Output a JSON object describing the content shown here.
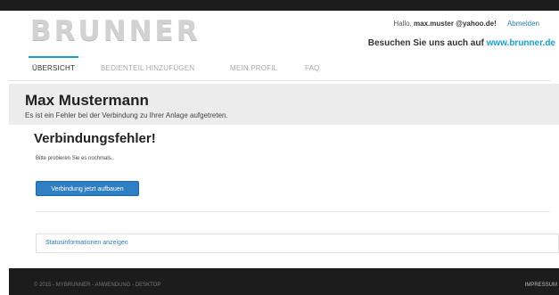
{
  "header": {
    "logo_text": "BRUNNER",
    "greeting_prefix": "Hallo,",
    "user_email": "max.muster @yahoo.de!",
    "logout_label": "Abmelden",
    "visit_text": "Besuchen Sie uns auch auf",
    "visit_link": "www.brunner.de"
  },
  "nav": {
    "tabs": [
      {
        "label": "ÜBERSICHT",
        "active": true
      },
      {
        "label": "BEDIENTEIL HINZUFÜGEN",
        "active": false
      },
      {
        "label": "MEIN PROFIL",
        "active": false
      },
      {
        "label": "FAQ",
        "active": false
      }
    ]
  },
  "hero": {
    "title": "Max Mustermann",
    "subtitle": "Es ist ein Fehler bei der Verbindung zu Ihrer Anlage aufgetreten."
  },
  "error": {
    "title": "Verbindungsfehler!",
    "message": "Bitte probieren Sie es nochmals..",
    "button_label": "Verbindung jetzt aufbauen"
  },
  "status": {
    "link_label": "Statusinformationen anzeigen"
  },
  "footer": {
    "copyright": "© 2015 - MYBRUNNER - ANWENDUNG - DESKTOP",
    "impressum_label": "IMPRESSUM"
  },
  "colors": {
    "accent": "#1a9fd4",
    "button": "#2e7fc4",
    "footer_bg": "#1c1c1c"
  }
}
